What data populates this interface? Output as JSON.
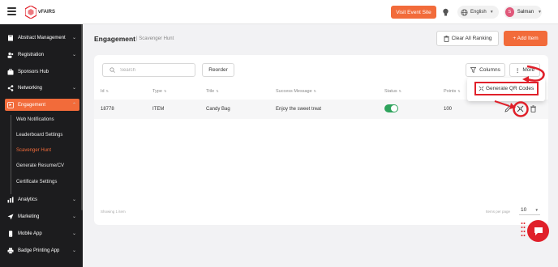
{
  "header": {
    "logo_text": "vFAIRS",
    "visit_label": "Visit Event Site",
    "language": "English",
    "user_initial": "S",
    "user_name": "Salman"
  },
  "sidebar": {
    "items": [
      {
        "label": "Abstract Management",
        "icon": "book-icon"
      },
      {
        "label": "Registration",
        "icon": "users-icon"
      },
      {
        "label": "Sponsors Hub",
        "icon": "briefcase-icon"
      },
      {
        "label": "Networking",
        "icon": "share-icon"
      },
      {
        "label": "Engagement",
        "icon": "flag-icon"
      },
      {
        "label": "Analytics",
        "icon": "bar-chart-icon"
      },
      {
        "label": "Marketing",
        "icon": "send-icon"
      },
      {
        "label": "Mobile App",
        "icon": "mobile-icon"
      },
      {
        "label": "Badge Printing App",
        "icon": "printer-icon"
      }
    ],
    "sub_items": [
      "Web Notifications",
      "Leaderboard Settings",
      "Scavenger Hunt",
      "Generate Resume/CV",
      "Certificate Settings"
    ]
  },
  "page": {
    "title": "Engagement",
    "subtitle": "| Scavenger Hunt",
    "clear_label": "Clear All Ranking",
    "add_label": "+ Add Item"
  },
  "toolbar": {
    "search_placeholder": "Search",
    "reorder_label": "Reorder",
    "columns_label": "Columns",
    "more_label": "More",
    "dropdown_item": "Generate QR Codes"
  },
  "table": {
    "columns": [
      "Id",
      "Type",
      "Title",
      "Success Message",
      "Status",
      "Points"
    ],
    "rows": [
      {
        "id": "18778",
        "type": "ITEM",
        "title": "Candy Bag",
        "message": "Enjoy the sweet treat",
        "status": true,
        "points": "100"
      }
    ]
  },
  "footer": {
    "showing": "Showing 1 item",
    "items_per_page_label": "Items per page",
    "items_per_page": "10"
  },
  "colors": {
    "accent": "#f26b3a",
    "sidebar_bg": "#1c1c1e",
    "toggle_on": "#2ea35c",
    "annotation": "#e0202a"
  }
}
